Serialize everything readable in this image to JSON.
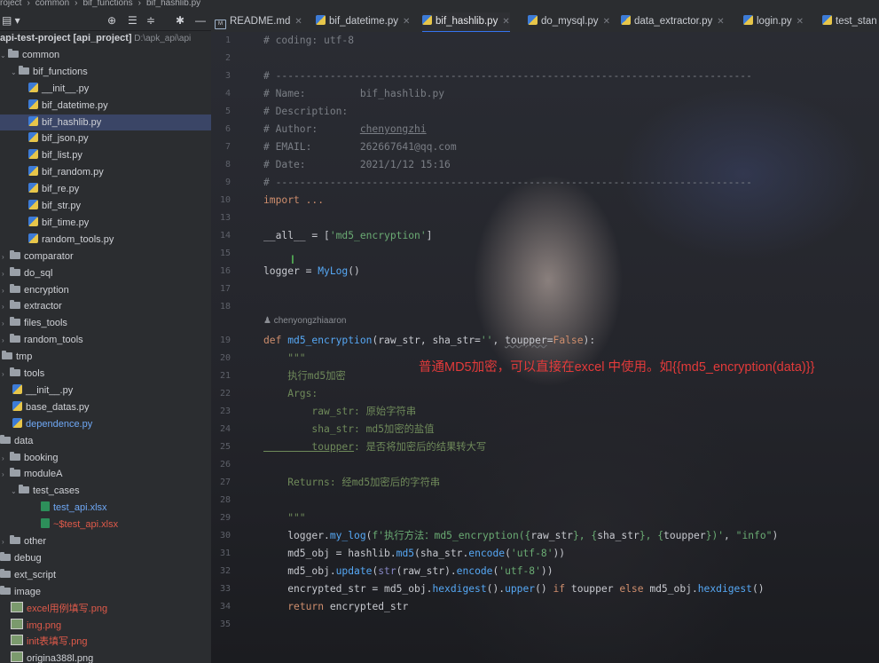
{
  "breadcrumb": [
    "roject",
    "common",
    "bif_functions",
    "bif_hashlib.py"
  ],
  "tabs": [
    {
      "label": "README.md",
      "kind": "md"
    },
    {
      "label": "bif_datetime.py",
      "kind": "py"
    },
    {
      "label": "bif_hashlib.py",
      "kind": "py",
      "active": true
    },
    {
      "label": "do_mysql.py",
      "kind": "py"
    },
    {
      "label": "data_extractor.py",
      "kind": "py"
    },
    {
      "label": "login.py",
      "kind": "py"
    },
    {
      "label": "test_stan",
      "kind": "py"
    }
  ],
  "tree": [
    {
      "text": "api-test-project [api_project]",
      "suffix": " D:\\apk_api\\api",
      "indent": 0,
      "icon": "none",
      "bold": true
    },
    {
      "text": "common",
      "indent": 0,
      "icon": "folder",
      "arrow": "down"
    },
    {
      "text": "bif_functions",
      "indent": 12,
      "icon": "folder",
      "arrow": "down"
    },
    {
      "text": "__init__.py",
      "indent": 32,
      "icon": "py"
    },
    {
      "text": "bif_datetime.py",
      "indent": 32,
      "icon": "py"
    },
    {
      "text": "bif_hashlib.py",
      "indent": 32,
      "icon": "py",
      "selected": true
    },
    {
      "text": "bif_json.py",
      "indent": 32,
      "icon": "py"
    },
    {
      "text": "bif_list.py",
      "indent": 32,
      "icon": "py"
    },
    {
      "text": "bif_random.py",
      "indent": 32,
      "icon": "py"
    },
    {
      "text": "bif_re.py",
      "indent": 32,
      "icon": "py"
    },
    {
      "text": "bif_str.py",
      "indent": 32,
      "icon": "py"
    },
    {
      "text": "bif_time.py",
      "indent": 32,
      "icon": "py"
    },
    {
      "text": "random_tools.py",
      "indent": 32,
      "icon": "py"
    },
    {
      "text": "comparator",
      "indent": 2,
      "icon": "folder",
      "arrow": "right"
    },
    {
      "text": "do_sql",
      "indent": 2,
      "icon": "folder",
      "arrow": "right"
    },
    {
      "text": "encryption",
      "indent": 2,
      "icon": "folder",
      "arrow": "right"
    },
    {
      "text": "extractor",
      "indent": 2,
      "icon": "folder",
      "arrow": "right"
    },
    {
      "text": "files_tools",
      "indent": 2,
      "icon": "folder",
      "arrow": "right"
    },
    {
      "text": "random_tools",
      "indent": 2,
      "icon": "folder",
      "arrow": "right"
    },
    {
      "text": "tmp",
      "indent": 2,
      "icon": "folder"
    },
    {
      "text": "tools",
      "indent": 2,
      "icon": "folder",
      "arrow": "right"
    },
    {
      "text": "__init__.py",
      "indent": 14,
      "icon": "py"
    },
    {
      "text": "base_datas.py",
      "indent": 14,
      "icon": "py"
    },
    {
      "text": "dependence.py",
      "indent": 14,
      "icon": "py",
      "color": "#6fa8f5"
    },
    {
      "text": "data",
      "indent": 0,
      "icon": "folder"
    },
    {
      "text": "booking",
      "indent": 2,
      "icon": "folder",
      "arrow": "right"
    },
    {
      "text": "moduleA",
      "indent": 2,
      "icon": "folder",
      "arrow": "right"
    },
    {
      "text": "test_cases",
      "indent": 12,
      "icon": "folder",
      "arrow": "down"
    },
    {
      "text": "test_api.xlsx",
      "indent": 46,
      "icon": "xls",
      "color": "#6fa8f5"
    },
    {
      "text": "~$test_api.xlsx",
      "indent": 46,
      "icon": "xls",
      "color": "#e05a4a"
    },
    {
      "text": "other",
      "indent": 2,
      "icon": "folder",
      "arrow": "right"
    },
    {
      "text": "debug",
      "indent": 0,
      "icon": "folder"
    },
    {
      "text": "ext_script",
      "indent": 0,
      "icon": "folder"
    },
    {
      "text": "image",
      "indent": 0,
      "icon": "folder"
    },
    {
      "text": "excel用例填写.png",
      "indent": 12,
      "icon": "png",
      "color": "#e05a4a"
    },
    {
      "text": "img.png",
      "indent": 12,
      "icon": "png",
      "color": "#e05a4a"
    },
    {
      "text": "init表填写.png",
      "indent": 12,
      "icon": "png",
      "color": "#e05a4a"
    },
    {
      "text": "origina388l.png",
      "indent": 12,
      "icon": "png"
    }
  ],
  "line_numbers": [
    "1",
    "2",
    "3",
    "4",
    "5",
    "6",
    "7",
    "8",
    "9",
    "10",
    "13",
    "14",
    "15",
    "16",
    "17",
    "18",
    "19",
    "20",
    "21",
    "22",
    "23",
    "24",
    "25",
    "26",
    "27",
    "28",
    "29",
    "30",
    "31",
    "32",
    "33",
    "34",
    "35"
  ],
  "author_hint": "chenyongzhiaaron",
  "annotation": "普通MD5加密，可以直接在excel 中使用。如{{md5_encryption(data)}}",
  "code": {
    "l1": "# coding: utf-8",
    "l3": "# -------------------------------------------------------------------------------",
    "l4a": "# Name:         ",
    "l4b": "bif_hashlib.py",
    "l5": "# Description:",
    "l6a": "# Author:       ",
    "l6b": "chenyongzhi",
    "l7a": "# EMAIL:        ",
    "l7b": "262667641@qq.com",
    "l8a": "# Date:         ",
    "l8b": "2021/1/12 15:16",
    "l9": "# -------------------------------------------------------------------------------",
    "l10": "import ...",
    "l14a": "__all__ = [",
    "l14b": "'md5_encryption'",
    "l14c": "]",
    "l16a": "logger = ",
    "l16b": "MyLog",
    "l16c": "()",
    "l19a": "def ",
    "l19b": "md5_encryption",
    "l19c": "(raw_str, sha_str=",
    "l19d": "''",
    "l19e": ", ",
    "l19f": "toupper",
    "l19g": "=",
    "l19h": "False",
    "l19i": "):",
    "l20": "    \"\"\"",
    "l21": "    执行md5加密",
    "l22": "    Args:",
    "l23a": "        raw_str",
    "l23b": ": 原始字符串",
    "l24a": "        sha_str",
    "l24b": ": md5加密的盐值",
    "l25a": "        toupper",
    "l25b": ": 是否将加密后的结果转大写",
    "l27": "    Returns: 经md5加密后的字符串",
    "l29": "    \"\"\"",
    "l30a": "    logger.",
    "l30b": "my_log",
    "l30c": "(",
    "l30d": "f'执行方法：md5_encryption({",
    "l30e": "raw_str",
    "l30f": "}, {",
    "l30g": "sha_str",
    "l30h": "}, {",
    "l30i": "toupper",
    "l30j": "})'",
    "l30k": ", ",
    "l30l": "\"info\"",
    "l30m": ")",
    "l31a": "    md5_obj = hashlib.",
    "l31b": "md5",
    "l31c": "(sha_str.",
    "l31d": "encode",
    "l31e": "(",
    "l31f": "'utf-8'",
    "l31g": "))",
    "l32a": "    md5_obj.",
    "l32b": "update",
    "l32c": "(",
    "l32d": "str",
    "l32e": "(raw_str).",
    "l32f": "encode",
    "l32g": "(",
    "l32h": "'utf-8'",
    "l32i": "))",
    "l33a": "    encrypted_str = md5_obj.",
    "l33b": "hexdigest",
    "l33c": "().",
    "l33d": "upper",
    "l33e": "() ",
    "l33f": "if",
    "l33g": " toupper ",
    "l33h": "else",
    "l33i": " md5_obj.",
    "l33j": "hexdigest",
    "l33k": "()",
    "l34a": "    ",
    "l34b": "return",
    "l34c": " encrypted_str"
  }
}
